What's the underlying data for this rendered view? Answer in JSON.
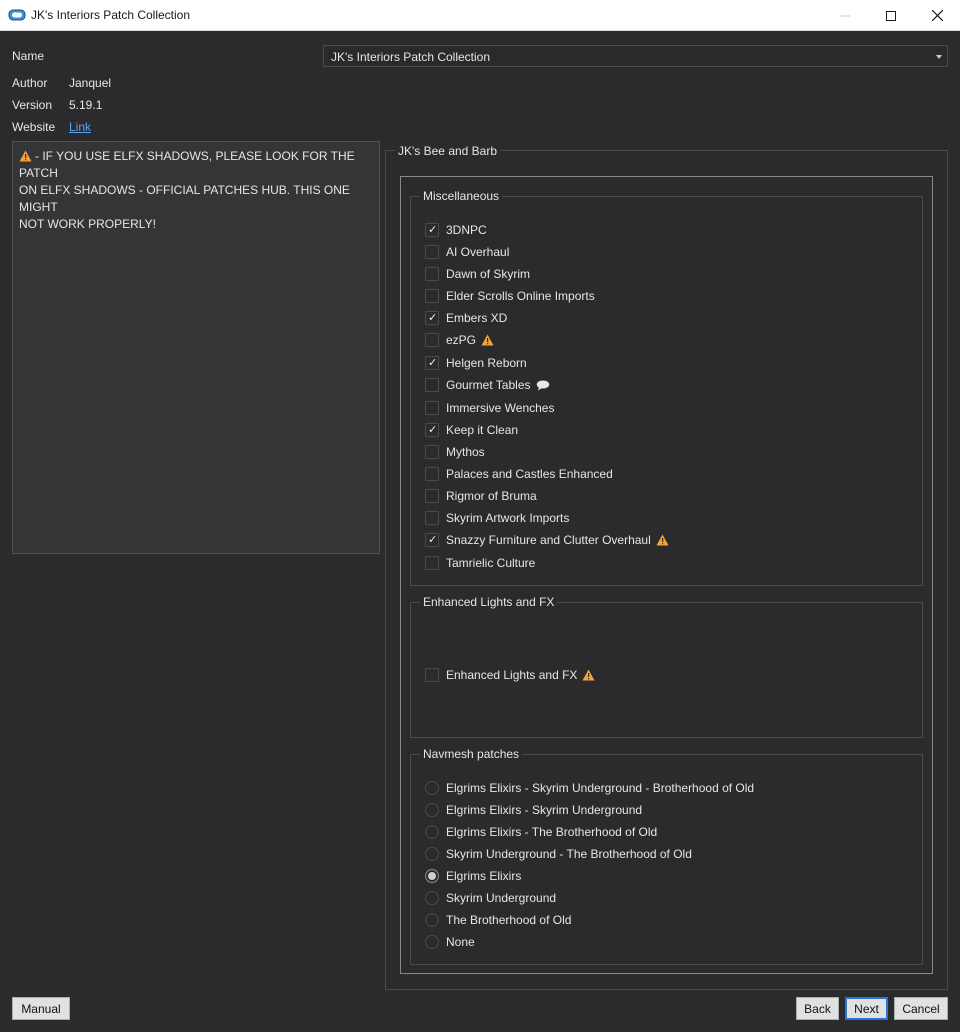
{
  "window": {
    "title": "JK's Interiors Patch Collection",
    "accent": "#2a74d8"
  },
  "info": {
    "name_label": "Name",
    "name_value": "JK's Interiors Patch Collection",
    "author_label": "Author",
    "author_value": "Janquel",
    "version_label": "Version",
    "version_value": "5.19.1",
    "website_label": "Website",
    "website_link": "Link"
  },
  "description": {
    "icon": "warning-icon",
    "lines": [
      "- IF YOU USE ELFX SHADOWS, PLEASE LOOK FOR THE PATCH",
      "ON ELFX SHADOWS - OFFICIAL PATCHES HUB. THIS ONE MIGHT",
      "NOT WORK PROPERLY!"
    ]
  },
  "page": {
    "title": "JK's Bee and Barb",
    "groups": [
      {
        "title": "Miscellaneous",
        "type": "checkbox",
        "options": [
          {
            "label": "3DNPC",
            "checked": true
          },
          {
            "label": "AI Overhaul",
            "checked": false
          },
          {
            "label": "Dawn of Skyrim",
            "checked": false
          },
          {
            "label": "Elder Scrolls Online Imports",
            "checked": false
          },
          {
            "label": "Embers XD",
            "checked": true
          },
          {
            "label": "ezPG",
            "checked": false,
            "icon": "warning-icon"
          },
          {
            "label": "Helgen Reborn",
            "checked": true
          },
          {
            "label": "Gourmet Tables",
            "checked": false,
            "icon": "speech-bubble-icon"
          },
          {
            "label": "Immersive Wenches",
            "checked": false
          },
          {
            "label": "Keep it Clean",
            "checked": true
          },
          {
            "label": "Mythos",
            "checked": false
          },
          {
            "label": "Palaces and Castles Enhanced",
            "checked": false
          },
          {
            "label": "Rigmor of Bruma",
            "checked": false
          },
          {
            "label": "Skyrim Artwork Imports",
            "checked": false
          },
          {
            "label": "Snazzy Furniture and Clutter Overhaul",
            "checked": true,
            "icon": "warning-icon"
          },
          {
            "label": "Tamrielic Culture",
            "checked": false
          }
        ]
      },
      {
        "title": "Enhanced Lights and FX",
        "type": "checkbox",
        "options": [
          {
            "label": "Enhanced Lights and FX",
            "checked": false,
            "icon": "warning-icon"
          }
        ]
      },
      {
        "title": "Navmesh patches",
        "type": "radio",
        "options": [
          {
            "label": "Elgrims Elixirs - Skyrim Underground - Brotherhood of Old",
            "checked": false
          },
          {
            "label": "Elgrims Elixirs - Skyrim Underground",
            "checked": false
          },
          {
            "label": "Elgrims Elixirs - The Brotherhood of Old",
            "checked": false
          },
          {
            "label": "Skyrim Underground - The Brotherhood of Old",
            "checked": false
          },
          {
            "label": "Elgrims Elixirs",
            "checked": true
          },
          {
            "label": "Skyrim Underground",
            "checked": false
          },
          {
            "label": "The Brotherhood of Old",
            "checked": false
          },
          {
            "label": "None",
            "checked": false
          }
        ]
      }
    ]
  },
  "buttons": {
    "manual": "Manual",
    "back": "Back",
    "next": "Next",
    "cancel": "Cancel"
  }
}
